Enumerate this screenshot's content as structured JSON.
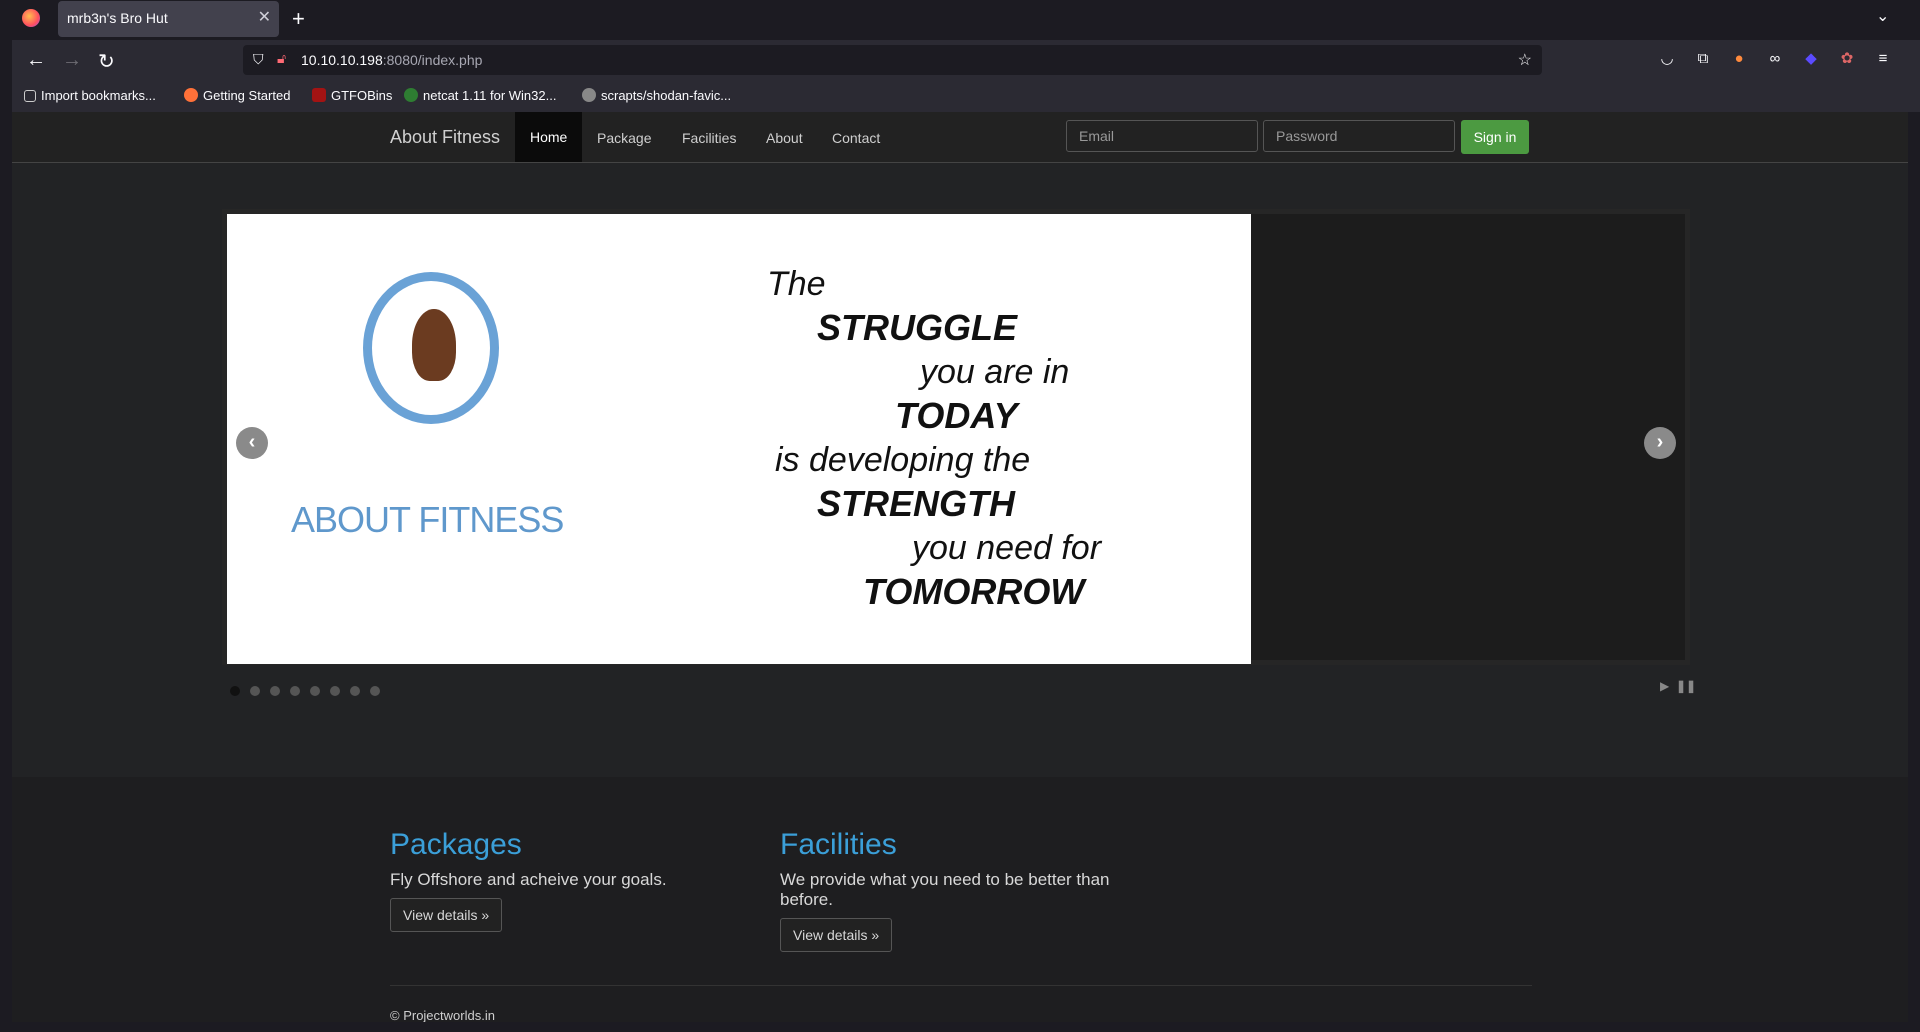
{
  "browser": {
    "tab_title": "mrb3n's Bro Hut",
    "url_host": "10.10.10.198",
    "url_rest": ":8080/index.php",
    "bookmarks": [
      "Import bookmarks...",
      "Getting Started",
      "GTFOBins",
      "netcat 1.11 for Win32...",
      "scrapts/shodan-favic..."
    ]
  },
  "site": {
    "brand": "About Fitness",
    "nav": [
      "Home",
      "Package",
      "Facilities",
      "About",
      "Contact"
    ],
    "login": {
      "email_placeholder": "Email",
      "password_placeholder": "Password",
      "signin": "Sign in"
    },
    "slide": {
      "logo_text": "ABOUT FITNESS",
      "quote": [
        "The",
        "STRUGGLE",
        "you are in",
        "TODAY",
        "is developing the",
        "STRENGTH",
        "you need for",
        "TOMORROW"
      ]
    },
    "slide_count": 8,
    "active_slide": 1,
    "sections": [
      {
        "title": "Packages",
        "text": "Fly Offshore and acheive your goals.",
        "button": "View details »"
      },
      {
        "title": "Facilities",
        "text": "We provide what you need to be better than before.",
        "button": "View details »"
      }
    ],
    "footer": "© Projectworlds.in"
  }
}
